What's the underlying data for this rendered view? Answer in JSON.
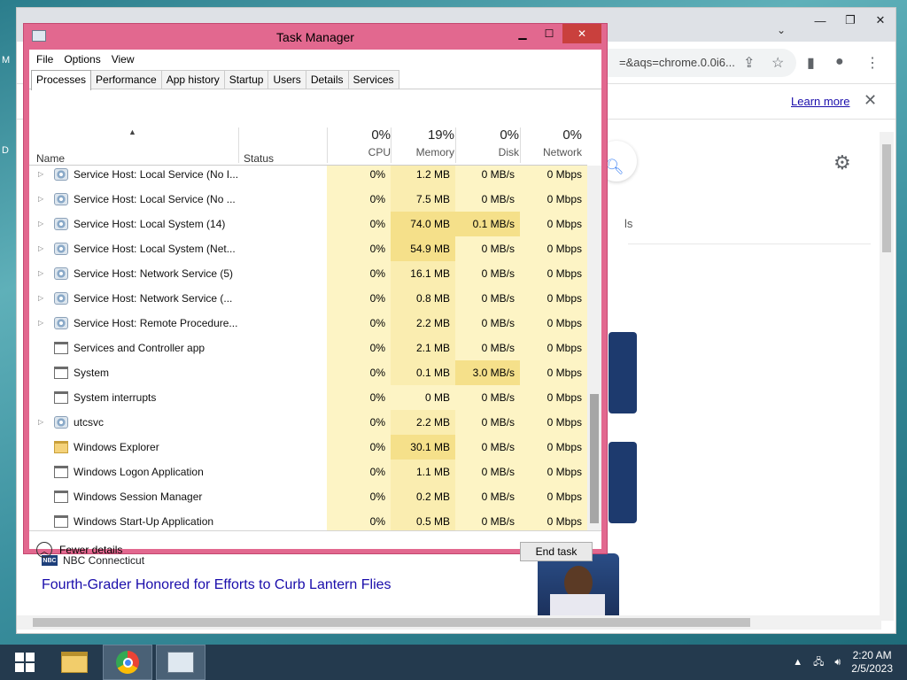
{
  "chrome": {
    "omnibox_text": "=&aqs=chrome.0.0i6...",
    "learn_more": "Learn more",
    "ls_fragment": "ls",
    "news_source": "NBC Connecticut",
    "news_logo": "NBC",
    "news_title": "Fourth-Grader Honored for Efforts to Curb Lantern Flies"
  },
  "task_manager": {
    "title": "Task Manager",
    "menu": [
      "File",
      "Options",
      "View"
    ],
    "tabs": [
      "Processes",
      "Performance",
      "App history",
      "Startup",
      "Users",
      "Details",
      "Services"
    ],
    "active_tab": "Processes",
    "columns": {
      "name": "Name",
      "status": "Status",
      "cpu": {
        "pct": "0%",
        "label": "CPU"
      },
      "memory": {
        "pct": "19%",
        "label": "Memory"
      },
      "disk": {
        "pct": "0%",
        "label": "Disk"
      },
      "network": {
        "pct": "0%",
        "label": "Network"
      }
    },
    "rows": [
      {
        "name": "Service Host: Local Service (No I...",
        "expandable": true,
        "icon": "gear",
        "cpu": "0%",
        "memory": "1.2 MB",
        "disk": "0 MB/s",
        "network": "0 Mbps"
      },
      {
        "name": "Service Host: Local Service (No ...",
        "expandable": true,
        "icon": "gear",
        "cpu": "0%",
        "memory": "7.5 MB",
        "disk": "0 MB/s",
        "network": "0 Mbps"
      },
      {
        "name": "Service Host: Local System (14)",
        "expandable": true,
        "icon": "gear",
        "cpu": "0%",
        "memory": "74.0 MB",
        "disk": "0.1 MB/s",
        "network": "0 Mbps"
      },
      {
        "name": "Service Host: Local System (Net...",
        "expandable": true,
        "icon": "gear",
        "cpu": "0%",
        "memory": "54.9 MB",
        "disk": "0 MB/s",
        "network": "0 Mbps"
      },
      {
        "name": "Service Host: Network Service (5)",
        "expandable": true,
        "icon": "gear",
        "cpu": "0%",
        "memory": "16.1 MB",
        "disk": "0 MB/s",
        "network": "0 Mbps"
      },
      {
        "name": "Service Host: Network Service (...",
        "expandable": true,
        "icon": "gear",
        "cpu": "0%",
        "memory": "0.8 MB",
        "disk": "0 MB/s",
        "network": "0 Mbps"
      },
      {
        "name": "Service Host: Remote Procedure...",
        "expandable": true,
        "icon": "gear",
        "cpu": "0%",
        "memory": "2.2 MB",
        "disk": "0 MB/s",
        "network": "0 Mbps"
      },
      {
        "name": "Services and Controller app",
        "expandable": false,
        "icon": "window",
        "cpu": "0%",
        "memory": "2.1 MB",
        "disk": "0 MB/s",
        "network": "0 Mbps"
      },
      {
        "name": "System",
        "expandable": false,
        "icon": "window",
        "cpu": "0%",
        "memory": "0.1 MB",
        "disk": "3.0 MB/s",
        "network": "0 Mbps"
      },
      {
        "name": "System interrupts",
        "expandable": false,
        "icon": "window",
        "cpu": "0%",
        "memory": "0 MB",
        "disk": "0 MB/s",
        "network": "0 Mbps"
      },
      {
        "name": "utcsvc",
        "expandable": true,
        "icon": "gear",
        "cpu": "0%",
        "memory": "2.2 MB",
        "disk": "0 MB/s",
        "network": "0 Mbps"
      },
      {
        "name": "Windows Explorer",
        "expandable": false,
        "icon": "folder",
        "cpu": "0%",
        "memory": "30.1 MB",
        "disk": "0 MB/s",
        "network": "0 Mbps"
      },
      {
        "name": "Windows Logon Application",
        "expandable": false,
        "icon": "window",
        "cpu": "0%",
        "memory": "1.1 MB",
        "disk": "0 MB/s",
        "network": "0 Mbps"
      },
      {
        "name": "Windows Session Manager",
        "expandable": false,
        "icon": "window",
        "cpu": "0%",
        "memory": "0.2 MB",
        "disk": "0 MB/s",
        "network": "0 Mbps"
      },
      {
        "name": "Windows Start-Up Application",
        "expandable": false,
        "icon": "window",
        "cpu": "0%",
        "memory": "0.5 MB",
        "disk": "0 MB/s",
        "network": "0 Mbps"
      }
    ],
    "fewer_details": "Fewer details",
    "end_task": "End task"
  },
  "taskbar": {
    "time": "2:20 AM",
    "date": "2/5/2023"
  },
  "colors": {
    "tm_border": "#e2688f",
    "cpu_col": "#fdf4c5",
    "mem_col": "#faedb0",
    "disk_col": "#fdf4c5",
    "net_col": "#fdf4c5",
    "hot_cell": "#f5e08a"
  }
}
